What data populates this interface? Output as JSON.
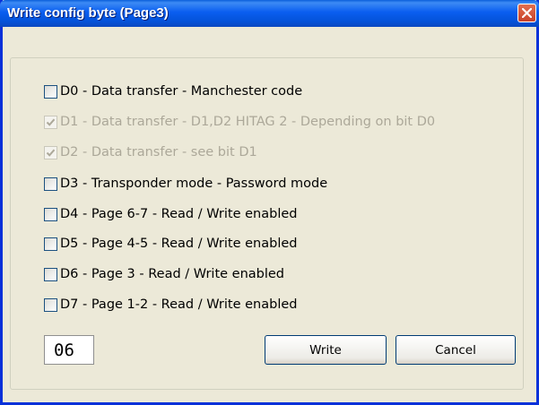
{
  "window": {
    "title": "Write config byte (Page3)"
  },
  "options": [
    {
      "label": "D0 - Data transfer - Manchester code",
      "checked": false,
      "enabled": true
    },
    {
      "label": "D1 - Data transfer - D1,D2 HITAG 2 - Depending on bit D0",
      "checked": true,
      "enabled": false
    },
    {
      "label": "D2 - Data transfer - see bit D1",
      "checked": true,
      "enabled": false
    },
    {
      "label": "D3 - Transponder mode - Password mode",
      "checked": false,
      "enabled": true
    },
    {
      "label": "D4 - Page 6-7 - Read / Write enabled",
      "checked": false,
      "enabled": true
    },
    {
      "label": "D5 - Page 4-5 - Read / Write enabled",
      "checked": false,
      "enabled": true
    },
    {
      "label": "D6 - Page 3 - Read / Write enabled",
      "checked": false,
      "enabled": true
    },
    {
      "label": "D7 - Page 1-2 - Read / Write enabled",
      "checked": false,
      "enabled": true
    }
  ],
  "value_display": "06",
  "buttons": {
    "write": "Write",
    "cancel": "Cancel"
  },
  "colors": {
    "titlebar": "#0a5ef0",
    "close": "#c8422a",
    "dialog_bg": "#ece9d8",
    "disabled_text": "#aca899"
  },
  "icons": {
    "close": "close-icon",
    "check": "checkmark-icon"
  }
}
